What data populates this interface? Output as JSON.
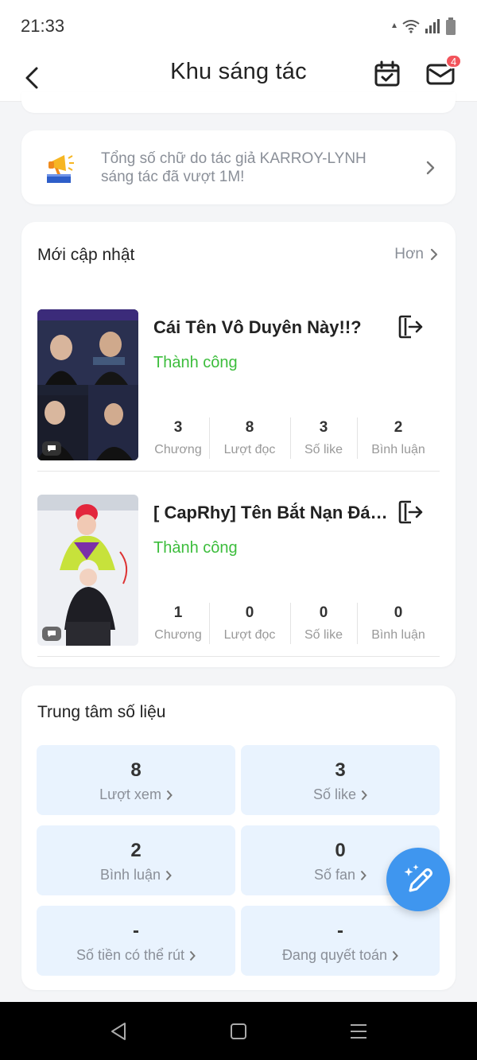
{
  "status_bar": {
    "time": "21:33",
    "icons": [
      "data-arrow-icon",
      "wifi-icon",
      "signal-icon",
      "battery-icon"
    ]
  },
  "header": {
    "title": "Khu sáng tác",
    "back_icon": "chevron-left-icon",
    "calendar_icon": "calendar-check-icon",
    "mail_icon": "mail-icon",
    "mail_badge": "4"
  },
  "notice": {
    "icon": "megaphone-podium-icon",
    "text": "Tổng số chữ do tác giả KARROY-LYNH sáng tác đã vượt 1M!"
  },
  "updates": {
    "title": "Mới cập nhật",
    "more_label": "Hơn",
    "books": [
      {
        "title": "Cái Tên Vô Duyên Này!!?",
        "status": "Thành công",
        "stats": [
          {
            "value": "3",
            "label": "Chương"
          },
          {
            "value": "8",
            "label": "Lượt đọc"
          },
          {
            "value": "3",
            "label": "Số like"
          },
          {
            "value": "2",
            "label": "Bình luận"
          }
        ]
      },
      {
        "title": "[ CapRhy] Tên Bắt Nạn Đán...",
        "status": "Thành công",
        "stats": [
          {
            "value": "1",
            "label": "Chương"
          },
          {
            "value": "0",
            "label": "Lượt đọc"
          },
          {
            "value": "0",
            "label": "Số like"
          },
          {
            "value": "0",
            "label": "Bình luận"
          }
        ]
      }
    ]
  },
  "data_center": {
    "title": "Trung tâm số liệu",
    "tiles": [
      {
        "value": "8",
        "label": "Lượt xem"
      },
      {
        "value": "3",
        "label": "Số like"
      },
      {
        "value": "2",
        "label": "Bình luận"
      },
      {
        "value": "0",
        "label": "Số fan"
      },
      {
        "value": "-",
        "label": "Số tiền có thể rút"
      },
      {
        "value": "-",
        "label": "Đang quyết toán"
      }
    ]
  },
  "fab": {
    "icon": "magic-pencil-icon"
  },
  "colors": {
    "accent_blue": "#3f96ef",
    "success_green": "#3cbd3c",
    "tile_bg": "#e9f3fe",
    "badge_red": "#f2545b"
  }
}
